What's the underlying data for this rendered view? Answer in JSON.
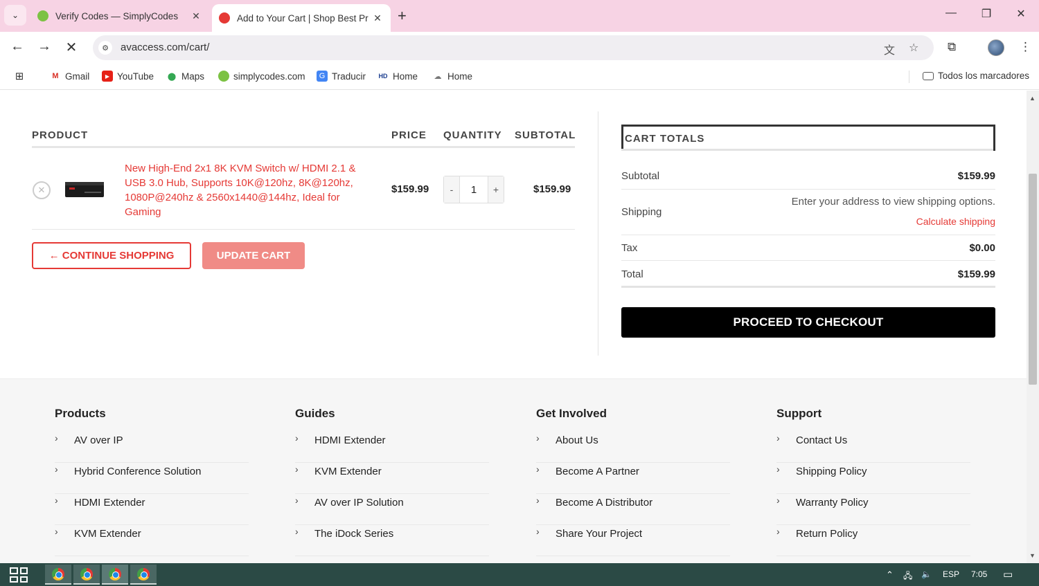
{
  "browser": {
    "tabs": [
      {
        "title": "Verify Codes — SimplyCodes",
        "active": false
      },
      {
        "title": "Add to Your Cart | Shop Best Pr",
        "active": true
      }
    ],
    "url": "avaccess.com/cart/",
    "bookmarks": [
      {
        "label": "Gmail",
        "icon": "gmail-icon"
      },
      {
        "label": "YouTube",
        "icon": "youtube-icon"
      },
      {
        "label": "Maps",
        "icon": "maps-icon"
      },
      {
        "label": "simplycodes.com",
        "icon": "simplycodes-icon"
      },
      {
        "label": "Traducir",
        "icon": "translate-icon"
      },
      {
        "label": "Home",
        "icon": "home-icon"
      },
      {
        "label": "Home",
        "icon": "home-icon"
      }
    ],
    "all_bookmarks": "Todos los marcadores"
  },
  "cart": {
    "headers": {
      "product": "PRODUCT",
      "price": "PRICE",
      "quantity": "QUANTITY",
      "subtotal": "SUBTOTAL"
    },
    "item": {
      "name": "New High-End 2x1 8K KVM Switch w/ HDMI 2.1 & USB 3.0 Hub, Supports 10K@120hz, 8K@120hz, 1080P@240hz & 2560x1440@144hz, Ideal for Gaming",
      "price": "$159.99",
      "quantity": "1",
      "qty_minus": "-",
      "qty_plus": "+",
      "subtotal": "$159.99"
    },
    "continue_label": "← CONTINUE SHOPPING",
    "update_label": "UPDATE CART"
  },
  "totals": {
    "title": "CART TOTALS",
    "subtotal_label": "Subtotal",
    "subtotal_value": "$159.99",
    "shipping_label": "Shipping",
    "shipping_message": "Enter your address to view shipping options.",
    "shipping_link": "Calculate shipping",
    "tax_label": "Tax",
    "tax_value": "$0.00",
    "total_label": "Total",
    "total_value": "$159.99",
    "checkout_label": "PROCEED TO CHECKOUT"
  },
  "footer": {
    "columns": [
      {
        "title": "Products",
        "items": [
          "AV over IP",
          "Hybrid Conference Solution",
          "HDMI Extender",
          "KVM Extender"
        ]
      },
      {
        "title": "Guides",
        "items": [
          "HDMI Extender",
          "KVM Extender",
          "AV over IP Solution",
          "The iDock Series"
        ]
      },
      {
        "title": "Get Involved",
        "items": [
          "About Us",
          "Become A Partner",
          "Become A Distributor",
          "Share Your Project"
        ]
      },
      {
        "title": "Support",
        "items": [
          "Contact Us",
          "Shipping Policy",
          "Warranty Policy",
          "Return Policy"
        ]
      }
    ]
  },
  "taskbar": {
    "language": "ESP",
    "time": "7:05"
  },
  "colors": {
    "accent": "#e53935",
    "update_button": "#f08b86",
    "tabbar": "#f7d3e4",
    "taskbar": "#2b4a45"
  }
}
